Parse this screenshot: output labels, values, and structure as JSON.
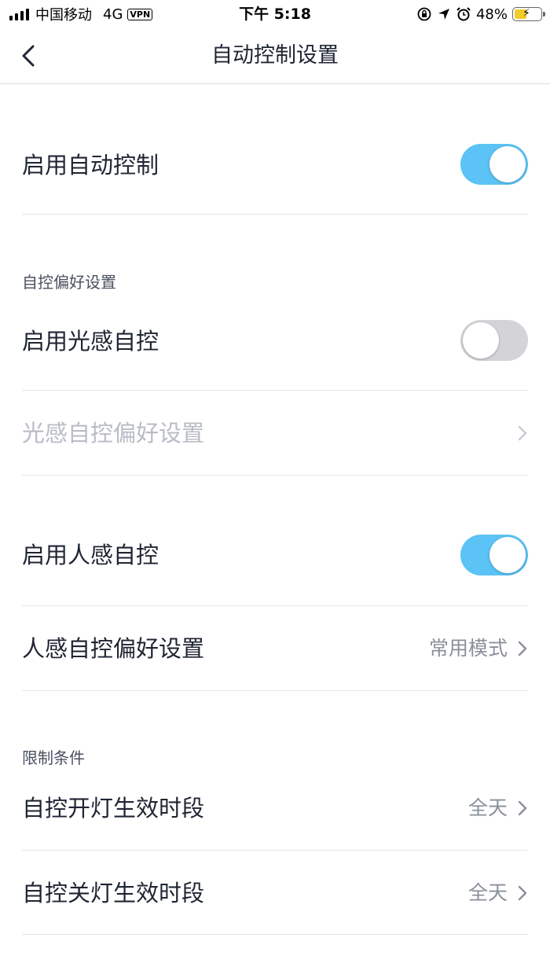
{
  "status_bar": {
    "carrier": "中国移动",
    "network": "4G",
    "vpn": "VPN",
    "time": "下午 5:18",
    "battery_percent": "48%",
    "battery_level": 0.48,
    "icons": [
      "signal-icon",
      "orientation-lock-icon",
      "location-icon",
      "alarm-icon",
      "battery-icon"
    ]
  },
  "nav": {
    "title": "自动控制设置",
    "back_icon": "chevron-left-icon"
  },
  "main_toggle": {
    "label": "启用自动控制",
    "enabled": true
  },
  "preferences_section": {
    "header": "自控偏好设置",
    "light_toggle": {
      "label": "启用光感自控",
      "enabled": false
    },
    "light_pref": {
      "label": "光感自控偏好设置",
      "disabled": true
    },
    "motion_toggle": {
      "label": "启用人感自控",
      "enabled": true
    },
    "motion_pref": {
      "label": "人感自控偏好设置",
      "value": "常用模式"
    }
  },
  "limits_section": {
    "header": "限制条件",
    "on_period": {
      "label": "自控开灯生效时段",
      "value": "全天"
    },
    "off_period": {
      "label": "自控关灯生效时段",
      "value": "全天"
    }
  },
  "colors": {
    "toggle_on": "#5bc3f5",
    "toggle_off": "#d4d4d8",
    "text_primary": "#1f2533",
    "text_disabled": "#b9bcc6",
    "text_secondary": "#8a8f9c",
    "divider": "#e4e6f0"
  }
}
